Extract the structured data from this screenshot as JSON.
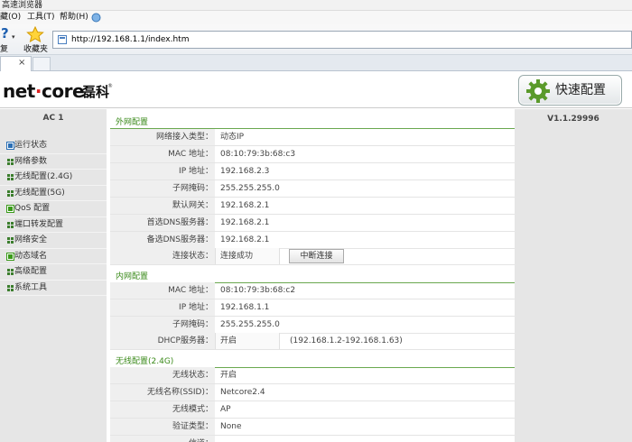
{
  "browser": {
    "title": "高速浏览器",
    "menu": [
      "藏(O)",
      "工具(T)",
      "帮助(H)"
    ],
    "back_label": "复",
    "favorites_label": "收藏夹",
    "url": "http://192.168.1.1/index.htm",
    "tab_close": "×"
  },
  "header": {
    "logo_net": "net",
    "logo_dot": "·",
    "logo_core": "core",
    "logo_cn": "磊科",
    "logo_reg": "®",
    "quick_setup": "快速配置"
  },
  "sidebar": {
    "model": "AC 1",
    "items": [
      {
        "label": "运行状态",
        "icon": "square-blue-icon",
        "color": "#2a6fb5"
      },
      {
        "label": "网络参数",
        "icon": "grid-icon",
        "color": "#3a7d2c"
      },
      {
        "label": "无线配置(2.4G)",
        "icon": "grid-icon",
        "color": "#3a7d2c"
      },
      {
        "label": "无线配置(5G)",
        "icon": "grid-icon",
        "color": "#3a7d2c"
      },
      {
        "label": "QoS 配置",
        "icon": "square-green-icon",
        "color": "#3a9a1a"
      },
      {
        "label": "端口转发配置",
        "icon": "grid-icon",
        "color": "#3a7d2c"
      },
      {
        "label": "网络安全",
        "icon": "grid-icon",
        "color": "#3a7d2c"
      },
      {
        "label": "动态域名",
        "icon": "square-green-icon",
        "color": "#3a9a1a"
      },
      {
        "label": "高级配置",
        "icon": "grid-icon",
        "color": "#3a7d2c"
      },
      {
        "label": "系统工具",
        "icon": "grid-icon",
        "color": "#3a7d2c"
      }
    ]
  },
  "version": "V1.1.29996",
  "wan": {
    "title": "外网配置",
    "rows": [
      {
        "key": "网络接入类型：",
        "value": "动态IP"
      },
      {
        "key": "MAC 地址：",
        "value": "08:10:79:3b:68:c3"
      },
      {
        "key": "IP 地址：",
        "value": "192.168.2.3"
      },
      {
        "key": "子网掩码：",
        "value": "255.255.255.0"
      },
      {
        "key": "默认网关：",
        "value": "192.168.2.1"
      },
      {
        "key": "首选DNS服务器：",
        "value": "192.168.2.1"
      },
      {
        "key": "备选DNS服务器：",
        "value": "192.168.2.1"
      }
    ],
    "status_key": "连接状态：",
    "status_value": "连接成功",
    "disconnect_label": "中断连接"
  },
  "lan": {
    "title": "内网配置",
    "rows": [
      {
        "key": "MAC 地址：",
        "value": "08:10:79:3b:68:c2"
      },
      {
        "key": "IP 地址：",
        "value": "192.168.1.1"
      },
      {
        "key": "子网掩码：",
        "value": "255.255.255.0"
      }
    ],
    "dhcp_key": "DHCP服务器：",
    "dhcp_value": "开启",
    "dhcp_range": "(192.168.1.2-192.168.1.63)"
  },
  "wlan24": {
    "title": "无线配置(2.4G)",
    "rows": [
      {
        "key": "无线状态：",
        "value": "开启"
      },
      {
        "key": "无线名称(SSID)：",
        "value": "Netcore2.4"
      },
      {
        "key": "无线模式：",
        "value": "AP"
      },
      {
        "key": "验证类型：",
        "value": "None"
      },
      {
        "key": "信道：",
        "value": ""
      }
    ]
  },
  "colors": {
    "section_title": "#3a8a1a",
    "section_rule": "#6aa84f",
    "sidebar_bg": "#e6e6e6",
    "logo_dot": "#d22222"
  }
}
